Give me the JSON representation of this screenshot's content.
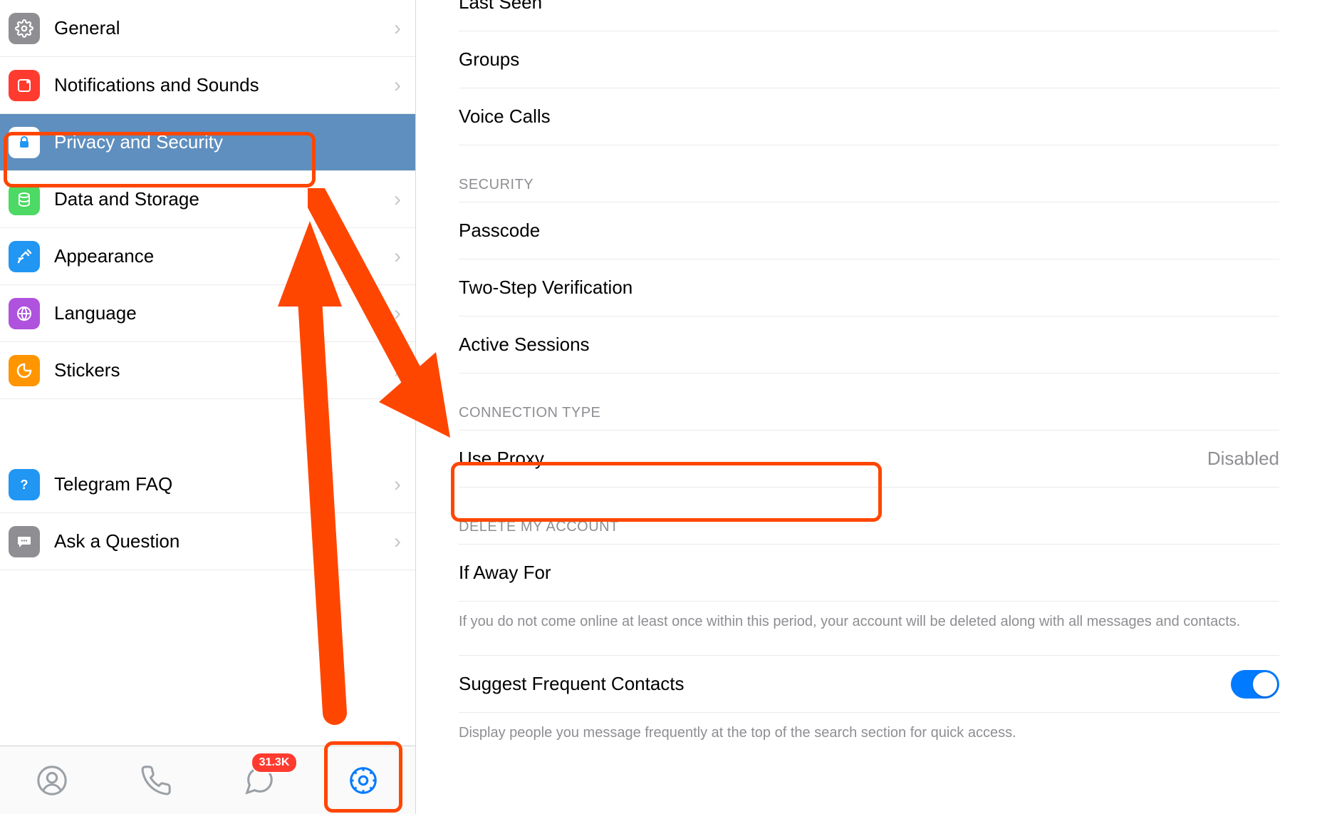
{
  "sidebar": {
    "items": [
      {
        "id": "general",
        "label": "General",
        "icon_bg": "#8e8e93",
        "icon": "gear"
      },
      {
        "id": "notifications",
        "label": "Notifications and Sounds",
        "icon_bg": "#ff3b30",
        "icon": "bell-square"
      },
      {
        "id": "privacy",
        "label": "Privacy and Security",
        "icon_bg": "#ffffff",
        "icon": "lock",
        "selected": true
      },
      {
        "id": "data",
        "label": "Data and Storage",
        "icon_bg": "#4cd964",
        "icon": "stack"
      },
      {
        "id": "appearance",
        "label": "Appearance",
        "icon_bg": "#2196f3",
        "icon": "brush"
      },
      {
        "id": "language",
        "label": "Language",
        "icon_bg": "#af52de",
        "icon": "globe"
      },
      {
        "id": "stickers",
        "label": "Stickers",
        "icon_bg": "#ff9500",
        "icon": "sticker"
      }
    ],
    "help_items": [
      {
        "id": "faq",
        "label": "Telegram FAQ",
        "icon_bg": "#2196f3",
        "icon": "question"
      },
      {
        "id": "ask",
        "label": "Ask a Question",
        "icon_bg": "#8e8e93",
        "icon": "chat"
      }
    ]
  },
  "tabbar": {
    "chats_badge": "31.3K"
  },
  "content": {
    "privacy_rows": [
      {
        "label": "Last Seen"
      },
      {
        "label": "Groups"
      },
      {
        "label": "Voice Calls"
      }
    ],
    "security_header": "SECURITY",
    "security_rows": [
      {
        "label": "Passcode"
      },
      {
        "label": "Two-Step Verification"
      },
      {
        "label": "Active Sessions"
      }
    ],
    "connection_header": "CONNECTION TYPE",
    "connection_row": {
      "label": "Use Proxy",
      "value": "Disabled"
    },
    "delete_header": "DELETE MY ACCOUNT",
    "delete_row": {
      "label": "If Away For"
    },
    "delete_footer": "If you do not come online at least once within this period, your account will be deleted along with all messages and contacts.",
    "suggest_row": {
      "label": "Suggest Frequent Contacts",
      "toggle_on": true
    },
    "suggest_footer": "Display people you message frequently at the top of the search section for quick access."
  },
  "annotations": {
    "color": "#ff4600"
  }
}
